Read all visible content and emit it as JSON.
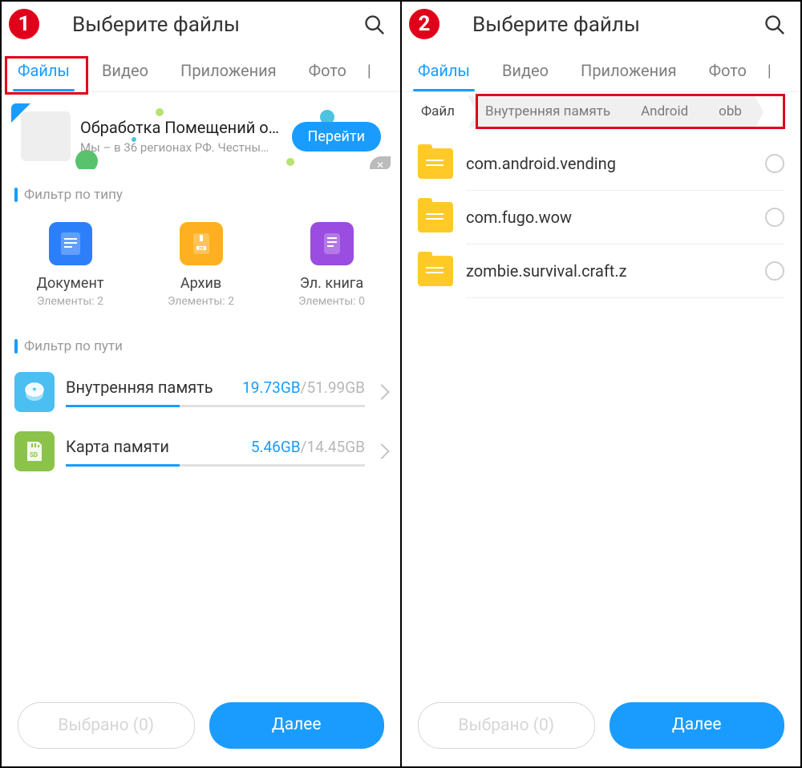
{
  "common": {
    "header_title": "Выберите файлы",
    "tabs": [
      "Файлы",
      "Видео",
      "Приложения",
      "Фото"
    ],
    "footer_selected": "Выбрано (0)",
    "footer_next": "Далее"
  },
  "pane1": {
    "step": "1",
    "ad": {
      "title": "Обработка Помещений о…",
      "sub": "Мы – в 36 регионах РФ. Честны…",
      "button": "Перейти"
    },
    "filter_type_header": "Фильтр по типу",
    "categories": [
      {
        "name": "Документ",
        "sub": "Элементы: 2",
        "color": "#2d7ff9"
      },
      {
        "name": "Архив",
        "sub": "Элементы: 2",
        "color": "#ffb020"
      },
      {
        "name": "Эл. книга",
        "sub": "Элементы: 0",
        "color": "#9a4de0"
      }
    ],
    "filter_path_header": "Фильтр по пути",
    "storage": [
      {
        "name": "Внутренняя память",
        "used": "19.73GB",
        "total": "51.99GB",
        "fill": 38,
        "kind": "disk"
      },
      {
        "name": "Карта памяти",
        "used": "5.46GB",
        "total": "14.45GB",
        "fill": 38,
        "kind": "sd"
      }
    ]
  },
  "pane2": {
    "step": "2",
    "crumbs": [
      "Файл",
      "Внутренняя память",
      "Android",
      "obb"
    ],
    "files": [
      "com.android.vending",
      "com.fugo.wow",
      "zombie.survival.craft.z"
    ]
  }
}
